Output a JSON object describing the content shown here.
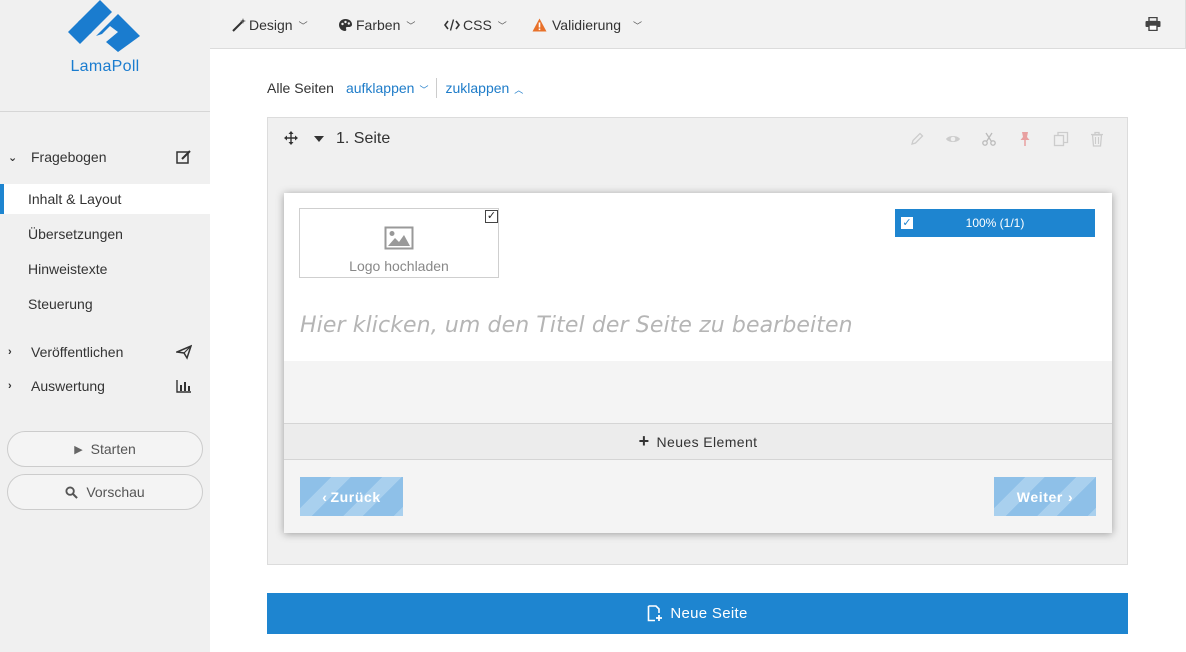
{
  "app": {
    "name": "LamaPoll",
    "brand_color": "#1e85d0"
  },
  "toolbar": {
    "design": "Design",
    "colors": "Farben",
    "css": "CSS",
    "validation": "Validierung",
    "validation_icon_color": "#e8712a"
  },
  "sidebar": {
    "sections": [
      {
        "label": "Fragebogen",
        "icon": "edit-icon",
        "expanded": true
      },
      {
        "label": "Veröffentlichen",
        "icon": "paper-plane-icon",
        "expanded": false
      },
      {
        "label": "Auswertung",
        "icon": "bar-chart-icon",
        "expanded": false
      }
    ],
    "sub_items": [
      {
        "label": "Inhalt & Layout",
        "active": true
      },
      {
        "label": "Übersetzungen",
        "active": false
      },
      {
        "label": "Hinweistexte",
        "active": false
      },
      {
        "label": "Steuerung",
        "active": false
      }
    ],
    "start_label": "Starten",
    "preview_label": "Vorschau"
  },
  "main": {
    "all_pages_label": "Alle Seiten",
    "expand_label": "aufklappen",
    "collapse_label": "zuklappen",
    "page": {
      "title": "1. Seite",
      "logo_upload_label": "Logo hochladen",
      "progress_label": "100% (1/1)",
      "title_placeholder": "Hier klicken, um den Titel der Seite zu bearbeiten",
      "new_element_label": "Neues Element",
      "back_label": "Zurück",
      "next_label": "Weiter"
    },
    "new_page_label": "Neue Seite"
  }
}
